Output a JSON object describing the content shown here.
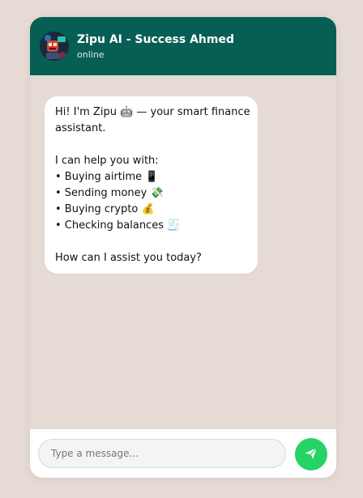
{
  "header": {
    "title": "Zipu AI - Success Ahmed",
    "status": "online",
    "avatar_icon": "robot-avatar-icon"
  },
  "messages": [
    {
      "sender": "bot",
      "lines": [
        "Hi! I'm Zipu 🤖 — your smart finance",
        "assistant.",
        "",
        "I can help you with:",
        "• Buying airtime 📱",
        "• Sending money 💸",
        "• Buying crypto 💰",
        "• Checking balances 🧾",
        "",
        "How can I assist you today?"
      ]
    }
  ],
  "composer": {
    "placeholder": "Type a message...",
    "value": "",
    "send_icon": "send-icon"
  },
  "colors": {
    "header_bg": "#075e54",
    "chat_bg": "#e6dbd4",
    "send_button": "#25d366",
    "bubble_bg": "#ffffff"
  }
}
